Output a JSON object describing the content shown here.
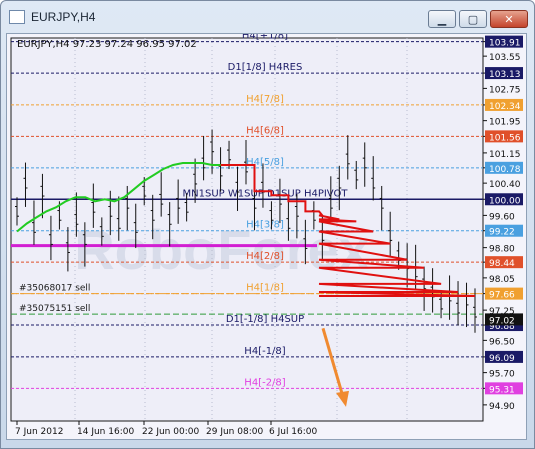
{
  "window": {
    "title": "EURJPY,H4",
    "buttons": {
      "minimize": "▁",
      "maximize": "▢",
      "close": "✕"
    }
  },
  "chart_data": {
    "type": "line",
    "title": "EURJPY,H4  97.23 97.24 96.95 97.02",
    "symbol": "EURJPY,H4",
    "ohlc": "97.23 97.24 96.95 97.02",
    "ylim": [
      94.5,
      104.0
    ],
    "grid": true,
    "y_ticks": [
      "103.91",
      "103.13",
      "102.34",
      "101.56",
      "100.78",
      "100.00",
      "99.22",
      "98.44",
      "97.66",
      "96.88",
      "96.09",
      "95.31",
      "103.55",
      "102.75",
      "101.95",
      "101.15",
      "100.40",
      "99.60",
      "98.80",
      "98.05",
      "97.25",
      "96.50",
      "95.70",
      "94.90"
    ],
    "y_tick_values": [
      103.91,
      103.13,
      102.34,
      101.56,
      100.78,
      100.0,
      99.22,
      98.44,
      97.66,
      96.88,
      96.09,
      95.31,
      103.55,
      102.75,
      101.95,
      101.15,
      100.4,
      99.6,
      98.8,
      98.05,
      97.25,
      96.5,
      95.7,
      94.9
    ],
    "x_ticks": [
      "7 Jun 2012",
      "14 Jun 16:00",
      "22 Jun 00:00",
      "29 Jun 08:00",
      "6 Jul 16:00"
    ],
    "levels": [
      {
        "name": "H4[+1/8]",
        "value": 103.91,
        "color": "#1a1a66"
      },
      {
        "name": "D1[1/8] H4RES",
        "value": 103.13,
        "color": "#1a1a66"
      },
      {
        "name": "H4[7/8]",
        "value": 102.34,
        "color": "#f0a030"
      },
      {
        "name": "H4[6/8]",
        "value": 101.56,
        "color": "#e0502a"
      },
      {
        "name": "H4[5/8]",
        "value": 100.78,
        "color": "#4aa0e0"
      },
      {
        "name": "MN1SUP W1SUP D1SUP H4PIVOT",
        "value": 100.0,
        "color": "#1a1a66"
      },
      {
        "name": "H4[3/8]",
        "value": 99.22,
        "color": "#4aa0e0"
      },
      {
        "name": "H4[2/8]",
        "value": 98.44,
        "color": "#e0502a"
      },
      {
        "name": "H4[1/8]",
        "value": 97.66,
        "color": "#f0a030"
      },
      {
        "name": "D1[-1/8] H4SUP",
        "value": 96.88,
        "color": "#1a1a66"
      },
      {
        "name": "H4[-1/8]",
        "value": 96.09,
        "color": "#1a1a66"
      },
      {
        "name": "H4[-2/8]",
        "value": 95.31,
        "color": "#e040e0"
      }
    ],
    "orders": [
      {
        "label": "#35068017 sell",
        "value": 97.66,
        "color": "#f0a030"
      },
      {
        "label": "#35075151 sell",
        "value": 97.15,
        "color": "#2f9a3a"
      }
    ],
    "magenta_line": {
      "value": 98.85
    },
    "support_step": [
      99.8,
      99.8,
      100.2,
      100.55,
      100.45,
      100.3,
      100.05,
      99.9,
      99.7,
      99.6,
      99.55,
      99.5,
      99.7,
      100.0
    ],
    "series": [
      {
        "name": "",
        "values": [
          99.7,
          100.4,
          99.3,
          100.2,
          99.0,
          99.6,
          98.8,
          99.5,
          99.0,
          99.8,
          99.2,
          99.7,
          99.4,
          99.9,
          99.3,
          100.2,
          99.6,
          100.0,
          99.5,
          99.9,
          99.8,
          100.5,
          100.9,
          101.3,
          100.7,
          101.1,
          100.3,
          100.8,
          99.9,
          100.3,
          99.6,
          100.0,
          99.4,
          99.7,
          98.9,
          99.6,
          99.1,
          99.9,
          100.4,
          101.0,
          100.6,
          100.9,
          100.4,
          99.9,
          99.1,
          98.6,
          98.4,
          98.2,
          97.9,
          97.7,
          97.4,
          97.6,
          97.3,
          97.5,
          97.2
        ]
      },
      {
        "name": "",
        "values": [
          99.2,
          99.4,
          99.55,
          99.7,
          99.8,
          99.95,
          100.05,
          100.05,
          99.95,
          100.0,
          99.95,
          100.05,
          100.25,
          100.45,
          100.6,
          100.75,
          100.85,
          100.9,
          100.9,
          100.9,
          100.85,
          100.85
        ]
      }
    ],
    "arrow": {
      "from_x_index": 51,
      "from_value": 96.7,
      "to_x_index": 53,
      "to_value": 94.8,
      "color": "#f08a30"
    },
    "watermark": "RoboForex"
  }
}
